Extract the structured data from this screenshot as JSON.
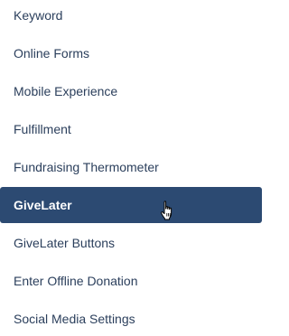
{
  "menu": {
    "items": [
      {
        "label": "Keyword"
      },
      {
        "label": "Online Forms"
      },
      {
        "label": "Mobile Experience"
      },
      {
        "label": "Fulfillment"
      },
      {
        "label": "Fundraising Thermometer"
      },
      {
        "label": "GiveLater"
      },
      {
        "label": "GiveLater Buttons"
      },
      {
        "label": "Enter Offline Donation"
      },
      {
        "label": "Social Media Settings"
      }
    ],
    "active_index": 5
  },
  "colors": {
    "text": "#2b3f5c",
    "active_background": "#2c4a72",
    "active_text": "#ffffff"
  },
  "pointer": {
    "icon": "hand-pointer-icon"
  }
}
